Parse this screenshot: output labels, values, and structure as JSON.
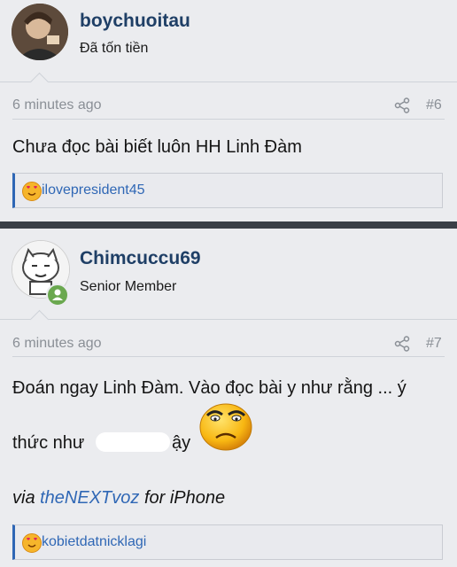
{
  "post1": {
    "username": "boychuoitau",
    "user_title": "Đã tốn tiền",
    "time": "6 minutes ago",
    "post_number": "#6",
    "message": "Chưa đọc bài biết luôn HH Linh Đàm",
    "reaction_user": "ilovepresident45"
  },
  "post2": {
    "username": "Chimcuccu69",
    "user_title": "Senior Member",
    "time": "6 minutes ago",
    "post_number": "#7",
    "message_line1": "Đoán ngay Linh Đàm. Vào đọc bài y như rằng ... ý",
    "message_line2_start": "thức như",
    "message_line2_end": "ậy",
    "signature_prefix": "via ",
    "signature_link": "theNEXTvoz",
    "signature_suffix": " for iPhone",
    "reaction_user": "kobietdatnicklagi"
  },
  "colors": {
    "username": "#1f3f66",
    "link": "#2f67b5",
    "online": "#6aa84f"
  }
}
